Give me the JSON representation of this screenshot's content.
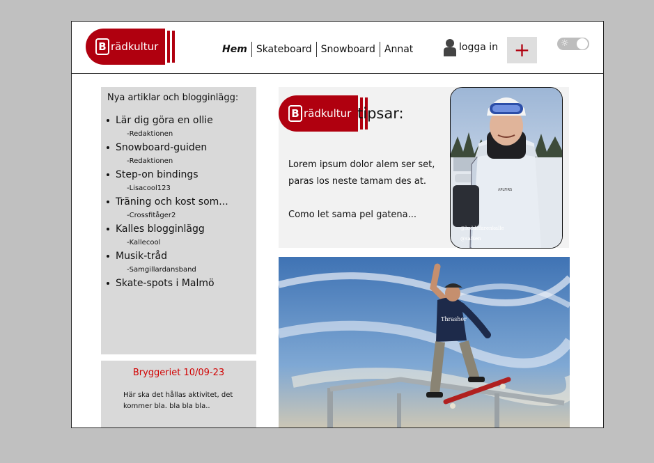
{
  "brand": {
    "name": "rädkultur",
    "letter": "B"
  },
  "nav": {
    "items": [
      {
        "label": "Hem",
        "active": true
      },
      {
        "label": "Skateboard",
        "active": false
      },
      {
        "label": "Snowboard",
        "active": false
      },
      {
        "label": "Annat",
        "active": false
      }
    ]
  },
  "login": {
    "label": "logga in",
    "icon": "user-icon"
  },
  "add_button": {
    "label": "+"
  },
  "theme_toggle": {
    "icon": "☼"
  },
  "sidebar": {
    "heading": "Nya artiklar och blogginlägg:",
    "items": [
      {
        "title": "Lär dig göra en ollie",
        "author": "-Redaktionen"
      },
      {
        "title": "Snowboard-guiden",
        "author": "-Redaktionen"
      },
      {
        "title": "Step-on bindings",
        "author": "-Lisacool123"
      },
      {
        "title": "Träning och kost som...",
        "author": "-Crossfitåger2"
      },
      {
        "title": "Kalles blogginlägg",
        "author": "-Kallecool"
      },
      {
        "title": "Musik-tråd",
        "author": "-Samgillardansband"
      },
      {
        "title": "Skate-spots i Malmö",
        "author": ""
      }
    ]
  },
  "event": {
    "title": "Bryggeriet  10/09-23",
    "text": "Här ska det hållas aktivitet, det kommer bla. bla bla bla.."
  },
  "tips": {
    "heading": "tipsar:",
    "paragraph1": "Lorem ipsum dolor alem ser set, paras los neste tamam des at.",
    "paragraph2": "Como let sama pel gatena...",
    "credit1": "@luddefarenkalle",
    "credit2": "@safsen"
  },
  "colors": {
    "brand": "#b0000f",
    "event_title": "#d10000"
  }
}
